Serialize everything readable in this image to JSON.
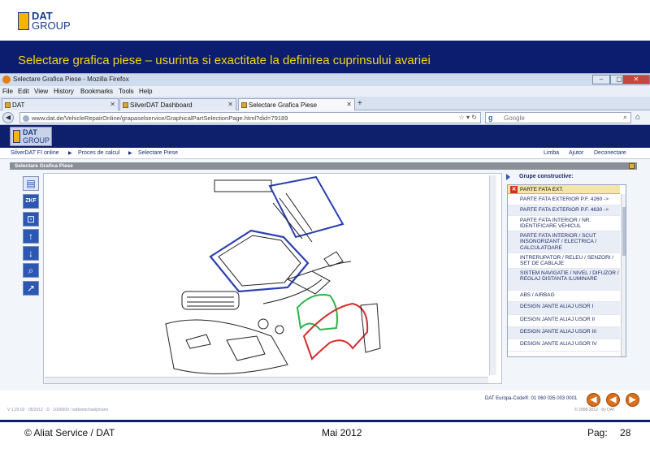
{
  "slide": {
    "logo_line1": "DAT",
    "logo_line2": "GROUP",
    "title": "Selectare grafica piese – usurinta si exactitate la definirea cuprinsului avariei",
    "footer_left": "© Aliat Service / DAT",
    "footer_center": "Mai 2012",
    "footer_page_label": "Pag:",
    "footer_page_number": "28"
  },
  "browser": {
    "window_title": "Selectare Grafica Piese - Mozilla Firefox",
    "menu": [
      "File",
      "Edit",
      "View",
      "History",
      "Bookmarks",
      "Tools",
      "Help"
    ],
    "tabs": [
      {
        "label": "DAT",
        "active": false
      },
      {
        "label": "SilverDAT Dashboard",
        "active": false
      },
      {
        "label": "Selectare Grafica Piese",
        "active": true
      }
    ],
    "url": "www.dat.de/VehicleRepairOnline/grapaselservice/GraphicalPartSelectionPage.html?did=79189",
    "search_placeholder": "Google"
  },
  "app": {
    "logo_line1": "DAT",
    "logo_line2": "GROUP",
    "breadcrumb": [
      "SilverDAT FI online",
      "Proces de calcul",
      "Selectare Piese"
    ],
    "top_links": [
      "Limba",
      "Ajutor",
      "Deconectare"
    ],
    "panel_title": "Selectare Grafica Piese",
    "tools": [
      "page-view",
      "zoom-zkf",
      "fit-view",
      "arrow-up",
      "arrow-down",
      "search-zoom",
      "pointer"
    ],
    "group_title": "Grupe constructive:",
    "group_selected": "PARTE FATA EXT.",
    "group_items": [
      "PARTE FATA EXTERIOR P.F. 4260 ->",
      "PARTE FATA EXTERIOR P.F. 4630 ->",
      "PARTE FATA INTERIOR / NR. IDENTIFICARE VEHICUL",
      "PARTE FATA INTERIOR / SCUT INSONORIZANT / ELECTRICA / CALCULATOARE",
      "INTRERUPATOR / RELEU / SENZORI / SET DE CABLAJE",
      "SISTEM NAVIGATIE / NIVEL / DIFUZOR / REGLAJ DISTANTA ILUMINARE",
      "ABS / AIRBAG",
      "DESIGN JANTE ALIAJ USOR I",
      "DESIGN JANTE ALIAJ USOR II",
      "DESIGN JANTE ALIAJ USOR III",
      "DESIGN JANTE ALIAJ USOR IV"
    ],
    "europa_code": "DAT Europa-Code®: 01 060 035 003 0001",
    "copyright": "© 2008-2012 · by DAT",
    "build_info": "V 1.29.02 · 05/2012 · D · 1000000 / wdbemichaeljohann"
  },
  "colors": {
    "title_band": "#0c1c6e",
    "title_text": "#f5d90a",
    "highlight_blue": "#2a3fb0",
    "highlight_green": "#2db34a",
    "highlight_red": "#d62b2b",
    "nav_orange": "#d9701c"
  }
}
